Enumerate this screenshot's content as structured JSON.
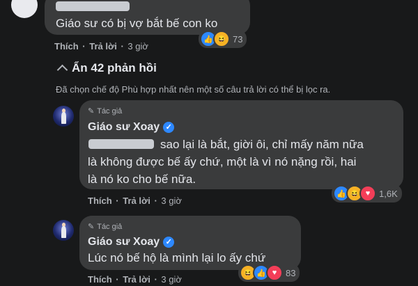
{
  "comment1": {
    "text": "Giáo sư có bị vợ bắt bế con ko",
    "actions": {
      "like": "Thích",
      "reply": "Trả lời",
      "time": "3 giờ"
    },
    "reactions": {
      "icons": [
        "like-icon",
        "haha-icon"
      ],
      "count": "73"
    }
  },
  "hidden_replies": {
    "label": "Ẩn 42 phản hồi",
    "icon": "chevron-up-icon"
  },
  "filter_notice": "Đã chọn chế độ Phù hợp nhất nên một số câu trả lời có thể bị lọc ra.",
  "reply1": {
    "author_tag": "Tác giả",
    "author_name": "Giáo sư Xoay",
    "line1": "sao lại là bắt, giời ôi, chỉ mấy năm nữa",
    "line2": "là không được bế ấy chứ, một là vì nó nặng rồi, hai",
    "line3": "là nó ko cho bế nữa.",
    "actions": {
      "like": "Thích",
      "reply": "Trả lời",
      "time": "3 giờ"
    },
    "reactions": {
      "icons": [
        "like-icon",
        "haha-icon",
        "love-icon"
      ],
      "count": "1,6K"
    }
  },
  "reply2": {
    "author_tag": "Tác giả",
    "author_name": "Giáo sư Xoay",
    "text": "Lúc nó bế hộ là mình lại lo ấy chứ",
    "actions": {
      "like": "Thích",
      "reply": "Trả lời",
      "time": "3 giờ"
    },
    "reactions": {
      "icons": [
        "haha-icon",
        "like-icon",
        "love-icon"
      ],
      "count": "83"
    }
  },
  "colors": {
    "background": "#18191a",
    "bubble": "#3a3b3c",
    "text": "#e4e6eb",
    "secondary": "#b0b3b8",
    "verified": "#2d88ff"
  }
}
